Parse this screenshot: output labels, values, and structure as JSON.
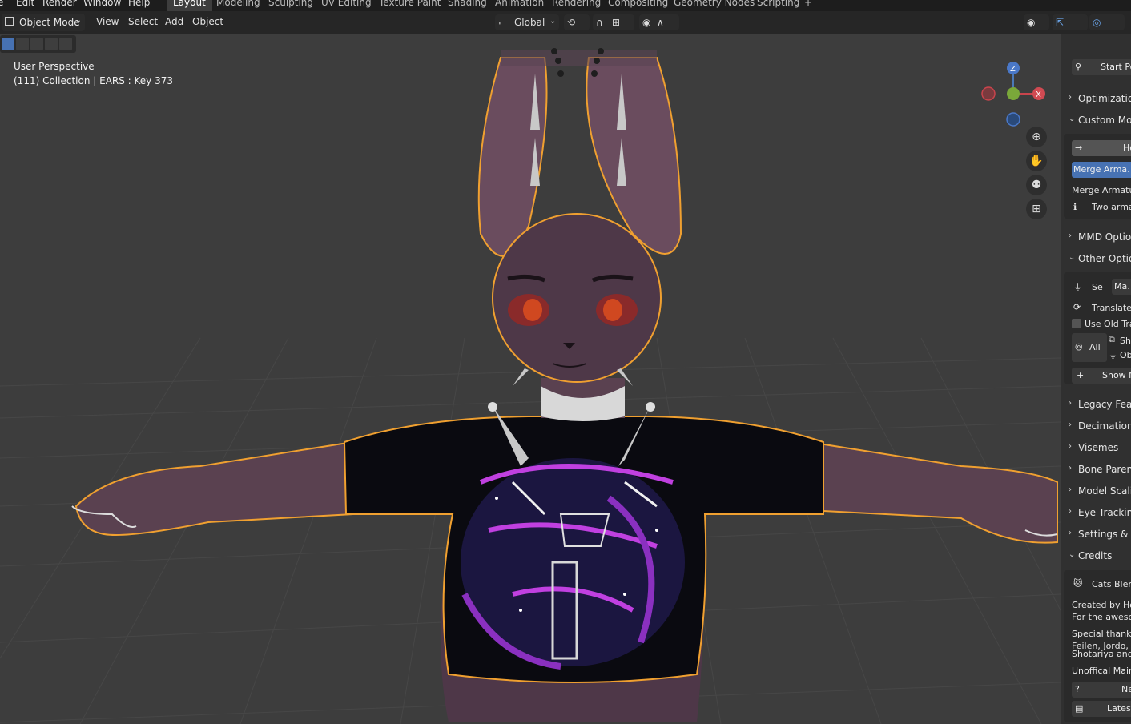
{
  "menu": {
    "edit": "Edit",
    "render": "Render",
    "window": "Window",
    "help": "Help"
  },
  "workspaces": [
    {
      "label": "Layout",
      "active": true
    },
    {
      "label": "Modeling"
    },
    {
      "label": "Sculpting"
    },
    {
      "label": "UV Editing"
    },
    {
      "label": "Texture Paint"
    },
    {
      "label": "Shading"
    },
    {
      "label": "Animation"
    },
    {
      "label": "Rendering"
    },
    {
      "label": "Compositing"
    },
    {
      "label": "Geometry Nodes"
    },
    {
      "label": "Scripting"
    },
    {
      "label": "+"
    }
  ],
  "header": {
    "mode": "Object Mode",
    "view": "View",
    "select": "Select",
    "add": "Add",
    "object": "Object",
    "orientation": "Global"
  },
  "viewport": {
    "perspective": "User Perspective",
    "collection_line": "(111) Collection | EARS : Key 373"
  },
  "gizmo": {
    "z": "Z",
    "x": "X"
  },
  "sidebar": {
    "start_pose": "Start Po",
    "optimization": "Optimization",
    "custom_model": "Custom Mode",
    "how_button": "Ho",
    "merge_armature_btn": "Merge Arma…",
    "merge_armature_label": "Merge Armatur",
    "two_arma": "Two arma",
    "mmd_options": "MMD Options",
    "other_options": "Other Option",
    "se": "Se",
    "ma": "Ma…",
    "translate": "Translate",
    "use_old": "Use Old Tra",
    "all": "All",
    "sh": "Sh",
    "ob": "Ob",
    "show": "Show M",
    "legacy": "Legacy Featu",
    "decimation": "Decimation",
    "visemes": "Visemes",
    "bone_parenting": "Bone Parentin",
    "model_scaling": "Model Scaling",
    "eye_tracking": "Eye Tracking",
    "settings": "Settings & Up",
    "credits": "Credits",
    "cats_blender": "Cats Blend",
    "created_by": "Created by Ho…",
    "for_the": "For the aweso…",
    "special_thanks": "Special thanks",
    "names1": "Feilen, Jordo, …",
    "names2": "Shotariya and I",
    "unofficial": "Unoffical Main…",
    "need": "Ne",
    "latest": "Latest"
  }
}
